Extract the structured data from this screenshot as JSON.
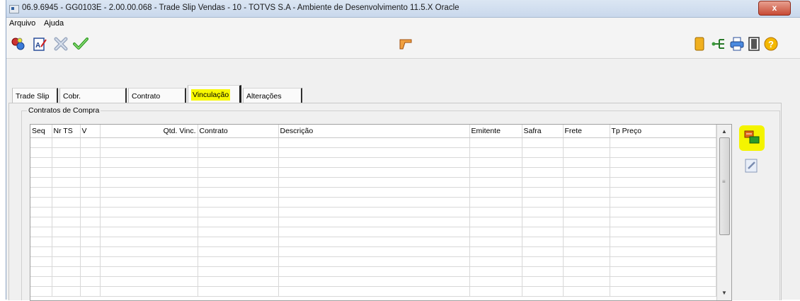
{
  "window": {
    "title": "06.9.6945 - GG0103E - 2.00.00.068 - Trade Slip Vendas - 10 - TOTVS S.A - Ambiente de Desenvolvimento 11.5.X Oracle",
    "close_label": "x"
  },
  "menu": [
    "Arquivo",
    "Ajuda"
  ],
  "toolbar": {
    "left_icons": [
      "query-icon",
      "edit-document-icon",
      "cancel-icon",
      "confirm-check-icon"
    ],
    "center_icon": "pointer-hand-icon",
    "right_icons": [
      "navigate-icon",
      "flow-icon",
      "print-icon",
      "exit-icon",
      "help-icon"
    ]
  },
  "tabs": [
    {
      "label": "Trade Slip",
      "active": false
    },
    {
      "label": "Cobr.",
      "active": false
    },
    {
      "label": "Contrato",
      "active": false
    },
    {
      "label": "Vinculação",
      "active": true
    },
    {
      "label": "Alterações",
      "active": false
    }
  ],
  "group": {
    "label": "Contratos de Compra"
  },
  "grid": {
    "columns": [
      "Seq",
      "Nr TS",
      "V",
      "Qtd. Vinc.",
      "Contrato",
      "Descrição",
      "Emitente",
      "Safra",
      "Frete",
      "Tp Preço"
    ],
    "rows": []
  },
  "side_buttons": [
    "add-link-icon",
    "edit-link-icon"
  ],
  "colors": {
    "highlight": "#f4f400"
  }
}
